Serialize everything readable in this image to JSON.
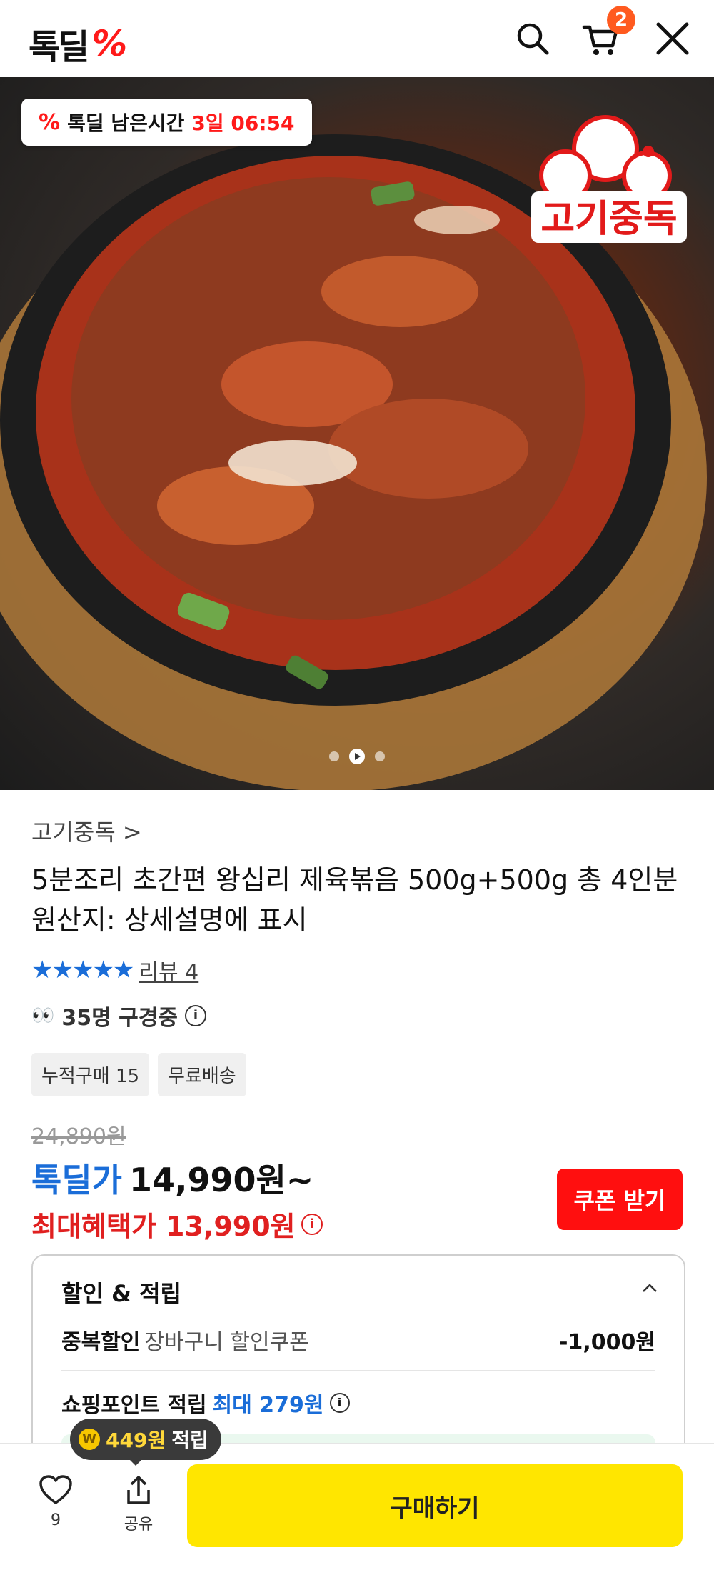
{
  "header": {
    "logo_text": "톡딜",
    "logo_mark": "%",
    "cart_count": "2",
    "icons": [
      "search-icon",
      "cart-icon",
      "close-icon"
    ]
  },
  "hero": {
    "timer_mark": "%",
    "timer_label": "톡딜 남은시간",
    "timer_value": "3일 06:54",
    "brand_stamp_text": "고기중독",
    "slide_current": 2,
    "slide_total": 3
  },
  "product": {
    "store": "고기중독 >",
    "title_line1": "5분조리 초간편 왕십리 제육볶음 500g+500g 총 4인분",
    "title_line2": "원산지: 상세설명에 표시",
    "stars": "★★★★★",
    "review": "리뷰 4",
    "viewers": "35명 구경중",
    "tags": [
      "누적구매 15",
      "무료배송"
    ]
  },
  "price": {
    "original": "24,890원",
    "deal_label": "톡딜가",
    "deal_price": "14,990원~",
    "max_benefit": "최대혜택가 13,990원",
    "coupon_button": "쿠폰 받기"
  },
  "benefits": {
    "title": "할인 & 적립",
    "discount_label": "중복할인",
    "discount_sub": "장바구니 할인쿠폰",
    "discount_value": "-1,000원",
    "points_label": "쇼핑포인트 적립",
    "points_value": "최대 279원"
  },
  "bottom": {
    "bubble_amount": "449원",
    "bubble_label": "적립",
    "like_count": "9",
    "share_label": "공유",
    "buy_label": "구매하기"
  },
  "colors": {
    "brand_red": "#ff1a1a",
    "deal_blue": "#1a6dd8",
    "buy_yellow": "#ffe600",
    "coupon_red": "#ff0f0f"
  }
}
